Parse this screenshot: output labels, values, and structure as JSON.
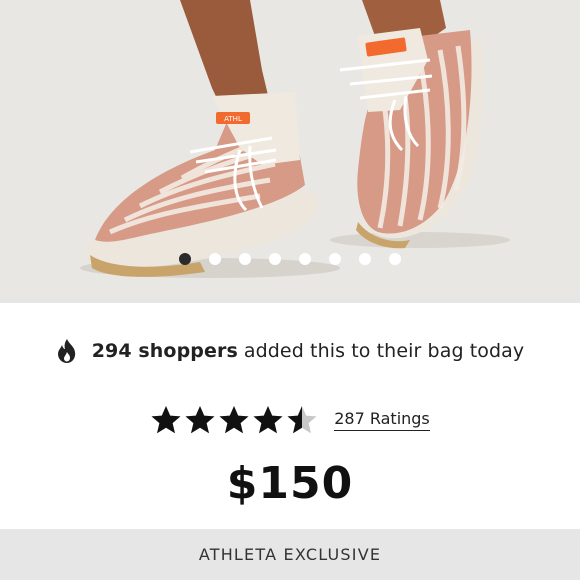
{
  "gallery": {
    "image_alt": "Pink and white knit running sneakers with white laces and gum soles",
    "shoe_logo_text": "ATHL",
    "dots": [
      {
        "active": true
      },
      {
        "active": false
      },
      {
        "active": false
      },
      {
        "active": false
      },
      {
        "active": false
      },
      {
        "active": false
      },
      {
        "active": false
      },
      {
        "active": false
      }
    ]
  },
  "social_proof": {
    "icon": "flame-icon",
    "count_text": "294 shoppers",
    "rest_text": "added this to their bag today"
  },
  "rating": {
    "stars": 4.5,
    "max_stars": 5,
    "link_text": "287 Ratings"
  },
  "price": "$150",
  "exclusive_label": "ATHLETA EXCLUSIVE",
  "colors": {
    "hero_bg": "#e9e7e4",
    "shoe_pink": "#d69a86",
    "shoe_cream": "#efe9df",
    "logo_orange": "#f26a2e",
    "badge_bg": "#e6e6e6"
  }
}
